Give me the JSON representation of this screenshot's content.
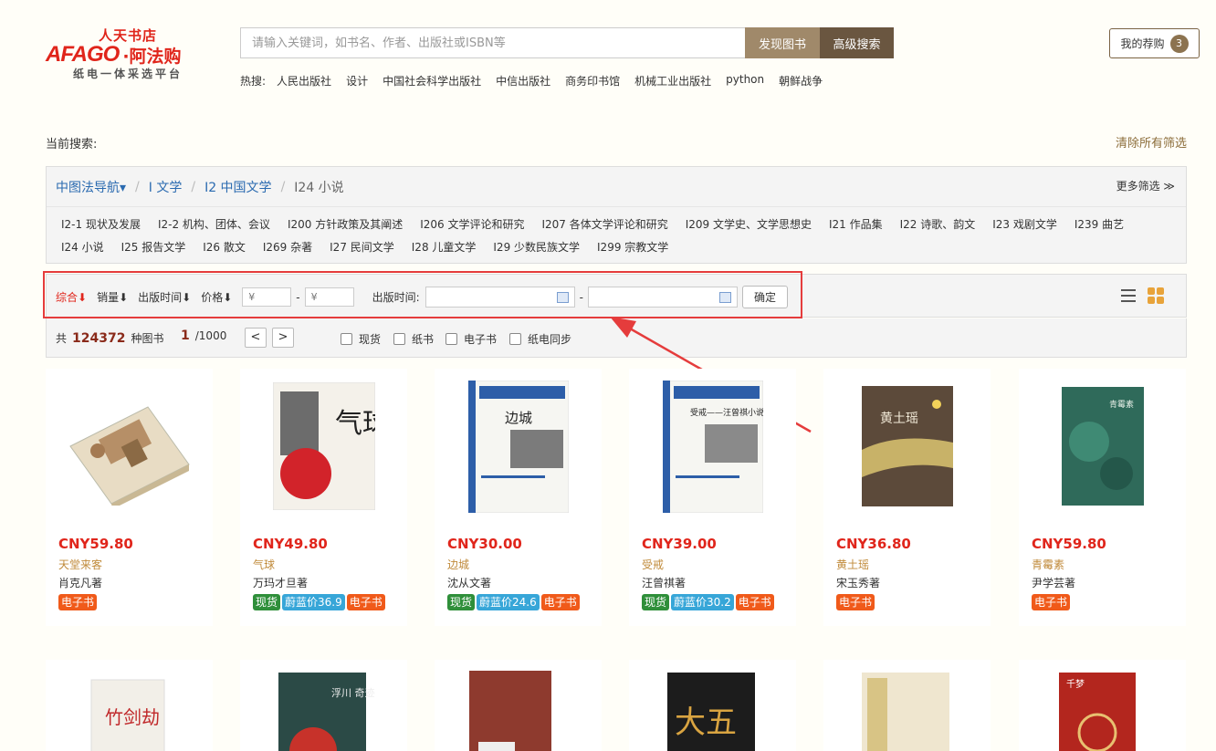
{
  "logo": {
    "top_text": "人天书店",
    "brand": "AFAGO",
    "brand_cn": "·阿法购",
    "tagline": "纸电一体采选平台"
  },
  "search": {
    "placeholder": "请输入关键词，如书名、作者、出版社或ISBN等",
    "find_label": "发现图书",
    "advanced_label": "高级搜索"
  },
  "hot": {
    "label": "热搜:",
    "items": [
      "人民出版社",
      "设计",
      "中国社会科学出版社",
      "中信出版社",
      "商务印书馆",
      "机械工业出版社",
      "python",
      "朝鲜战争"
    ]
  },
  "cart": {
    "label": "我的荐购",
    "count": "3"
  },
  "current_search": "当前搜索:",
  "clear_filters": "清除所有筛选",
  "breadcrumb": {
    "nav": "中图法导航▾",
    "items": [
      "I 文学",
      "I2 中国文学"
    ],
    "current": "I24 小说"
  },
  "more_filters": "更多筛选 ≫",
  "categories": [
    "I2-1 现状及发展",
    "I2-2 机构、团体、会议",
    "I200 方针政策及其阐述",
    "I206 文学评论和研究",
    "I207 各体文学评论和研究",
    "I209 文学史、文学思想史",
    "I21 作品集",
    "I22 诗歌、韵文",
    "I23 戏剧文学",
    "I239 曲艺",
    "I24 小说",
    "I25 报告文学",
    "I26 散文",
    "I269 杂著",
    "I27 民间文学",
    "I28 儿童文学",
    "I29 少数民族文学",
    "I299 宗教文学"
  ],
  "sort": {
    "comprehensive": "综合⬇",
    "sales": "销量⬇",
    "pubtime": "出版时间⬇",
    "price": "价格⬇",
    "price_min": "¥",
    "price_max": "¥",
    "dash": "-",
    "date_label": "出版时间:",
    "confirm": "确定"
  },
  "count": {
    "prefix": "共",
    "total": "124372",
    "suffix": "种图书",
    "page": "1",
    "pages": "/1000",
    "prev": "<",
    "next": ">"
  },
  "checks": [
    "现货",
    "纸书",
    "电子书",
    "纸电同步"
  ],
  "colors": {
    "accent_red": "#e0251b",
    "brown": "#6a5640",
    "tag_stock": "#2f8f3a",
    "tag_vip": "#37a6d8",
    "tag_ebook": "#f05a1a"
  },
  "products": [
    {
      "price": "CNY59.80",
      "title": "天堂来客",
      "author": "肖克凡著",
      "tags": [
        "电子书"
      ]
    },
    {
      "price": "CNY49.80",
      "title": "气球",
      "author": "万玛才旦著",
      "tags": [
        "现货",
        "蔚蓝价36.9",
        "电子书"
      ]
    },
    {
      "price": "CNY30.00",
      "title": "边城",
      "author": "沈从文著",
      "tags": [
        "现货",
        "蔚蓝价24.6",
        "电子书"
      ]
    },
    {
      "price": "CNY39.00",
      "title": "受戒",
      "author": "汪曾祺著",
      "tags": [
        "现货",
        "蔚蓝价30.2",
        "电子书"
      ]
    },
    {
      "price": "CNY36.80",
      "title": "黄土瑶",
      "author": "宋玉秀著",
      "tags": [
        "电子书"
      ]
    },
    {
      "price": "CNY59.80",
      "title": "青霉素",
      "author": "尹学芸著",
      "tags": [
        "电子书"
      ]
    }
  ],
  "covers": {
    "c2_text": "气球",
    "c3_title": "边城",
    "c4_title": "受戒——汪曾祺小说精选",
    "c5_title": "黄土瑶",
    "c6_title": "青霉素",
    "r2_1": "竹剑劫",
    "r2_2": "浮川 奇迹",
    "r2_4": "大五",
    "r2_6": "千梦"
  }
}
